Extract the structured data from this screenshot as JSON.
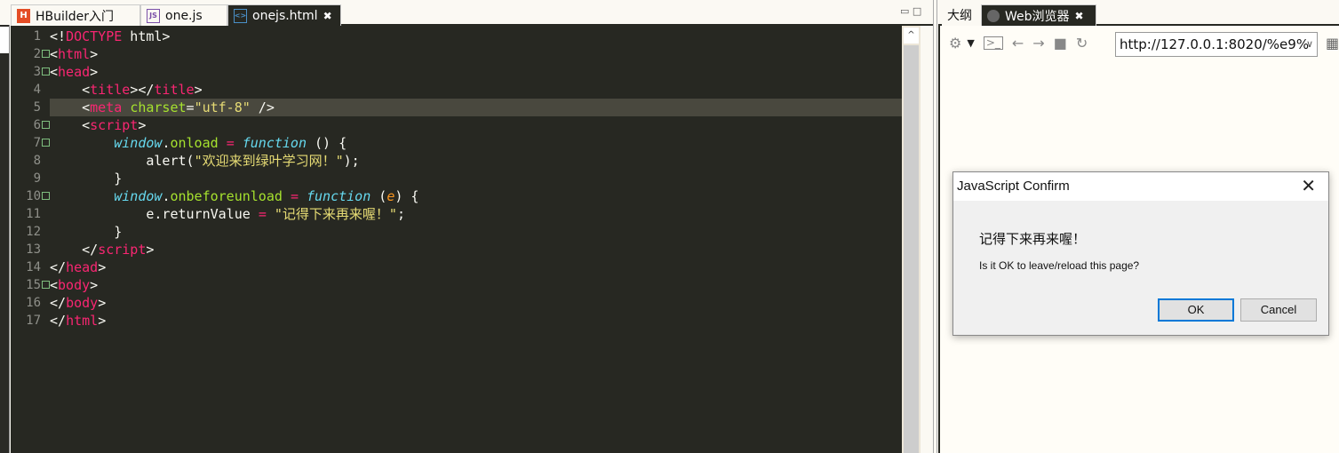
{
  "editor_tabs": [
    {
      "label": "HBuilder入门",
      "icon": "hbuilder-icon",
      "active": false
    },
    {
      "label": "one.js",
      "icon": "js-file-icon",
      "active": false
    },
    {
      "label": "onejs.html",
      "icon": "html-file-icon",
      "active": true
    }
  ],
  "right_tabs": [
    {
      "label": "大纲",
      "active": false
    },
    {
      "label": "Web浏览器",
      "icon": "globe-icon",
      "active": true
    }
  ],
  "close_glyph": "✖",
  "colors": {
    "editor_bg": "#272822",
    "tag": "#f92672",
    "attr": "#a6e22e",
    "string": "#e6db74",
    "keyword": "#66d9ef",
    "param": "#fd971f",
    "dialog_ok_border": "#0078d7"
  },
  "code": {
    "highlighted_line": 5,
    "lines": [
      {
        "n": "1",
        "fold": false,
        "tokens": [
          [
            "p",
            "<!"
          ],
          [
            "tag",
            "DOCTYPE"
          ],
          [
            "p",
            " html>"
          ]
        ]
      },
      {
        "n": "2",
        "fold": true,
        "tokens": [
          [
            "p",
            "<"
          ],
          [
            "tag",
            "html"
          ],
          [
            "p",
            ">"
          ]
        ]
      },
      {
        "n": "3",
        "fold": true,
        "tokens": [
          [
            "p",
            "<"
          ],
          [
            "tag",
            "head"
          ],
          [
            "p",
            ">"
          ]
        ]
      },
      {
        "n": "4",
        "fold": false,
        "tokens": [
          [
            "p",
            "    <"
          ],
          [
            "tag",
            "title"
          ],
          [
            "p",
            "></"
          ],
          [
            "tag",
            "title"
          ],
          [
            "p",
            ">"
          ]
        ]
      },
      {
        "n": "5",
        "fold": false,
        "tokens": [
          [
            "p",
            "    <"
          ],
          [
            "tag",
            "meta"
          ],
          [
            "p",
            " "
          ],
          [
            "attr",
            "charset"
          ],
          [
            "p",
            "="
          ],
          [
            "str",
            "\"utf-8\""
          ],
          [
            "p",
            " />"
          ]
        ]
      },
      {
        "n": "6",
        "fold": true,
        "tokens": [
          [
            "p",
            "    <"
          ],
          [
            "tag",
            "script"
          ],
          [
            "p",
            ">"
          ]
        ]
      },
      {
        "n": "7",
        "fold": true,
        "tokens": [
          [
            "p",
            "        "
          ],
          [
            "kw",
            "window"
          ],
          [
            "p",
            "."
          ],
          [
            "prop",
            "onload"
          ],
          [
            "p",
            " "
          ],
          [
            "op",
            "="
          ],
          [
            "p",
            " "
          ],
          [
            "kw",
            "function"
          ],
          [
            "p",
            " () {"
          ]
        ]
      },
      {
        "n": "8",
        "fold": false,
        "tokens": [
          [
            "p",
            "            alert("
          ],
          [
            "str",
            "\"欢迎来到绿叶学习网！\""
          ],
          [
            "p",
            ");"
          ]
        ]
      },
      {
        "n": "9",
        "fold": false,
        "tokens": [
          [
            "p",
            "        }"
          ]
        ]
      },
      {
        "n": "10",
        "fold": true,
        "tokens": [
          [
            "p",
            "        "
          ],
          [
            "kw",
            "window"
          ],
          [
            "p",
            "."
          ],
          [
            "prop",
            "onbeforeunload"
          ],
          [
            "p",
            " "
          ],
          [
            "op",
            "="
          ],
          [
            "p",
            " "
          ],
          [
            "kw",
            "function"
          ],
          [
            "p",
            " ("
          ],
          [
            "param",
            "e"
          ],
          [
            "p",
            ") {"
          ]
        ]
      },
      {
        "n": "11",
        "fold": false,
        "tokens": [
          [
            "p",
            "            e.returnValue "
          ],
          [
            "op",
            "="
          ],
          [
            "p",
            " "
          ],
          [
            "str",
            "\"记得下来再来喔！\""
          ],
          [
            "p",
            ";"
          ]
        ]
      },
      {
        "n": "12",
        "fold": false,
        "tokens": [
          [
            "p",
            "        }"
          ]
        ]
      },
      {
        "n": "13",
        "fold": false,
        "tokens": [
          [
            "p",
            "    </"
          ],
          [
            "tag",
            "script"
          ],
          [
            "p",
            ">"
          ]
        ]
      },
      {
        "n": "14",
        "fold": false,
        "tokens": [
          [
            "p",
            "</"
          ],
          [
            "tag",
            "head"
          ],
          [
            "p",
            ">"
          ]
        ]
      },
      {
        "n": "15",
        "fold": true,
        "tokens": [
          [
            "p",
            "<"
          ],
          [
            "tag",
            "body"
          ],
          [
            "p",
            ">"
          ]
        ]
      },
      {
        "n": "16",
        "fold": false,
        "tokens": [
          [
            "p",
            "</"
          ],
          [
            "tag",
            "body"
          ],
          [
            "p",
            ">"
          ]
        ]
      },
      {
        "n": "17",
        "fold": false,
        "tokens": [
          [
            "p",
            "</"
          ],
          [
            "tag",
            "html"
          ],
          [
            "p",
            ">"
          ]
        ]
      }
    ]
  },
  "browser": {
    "toolbar_icons": [
      "gear-icon",
      "dropdown-arrow-icon",
      "console-icon",
      "back-arrow-icon",
      "forward-arrow-icon",
      "stop-icon",
      "refresh-icon"
    ],
    "url": "http://127.0.0.1:8020/%e9%",
    "qr_icon": "qr-code-icon"
  },
  "dialog": {
    "title": "JavaScript Confirm",
    "message": "记得下来再来喔！",
    "question": "Is it OK to leave/reload this page?",
    "ok_label": "OK",
    "cancel_label": "Cancel"
  }
}
